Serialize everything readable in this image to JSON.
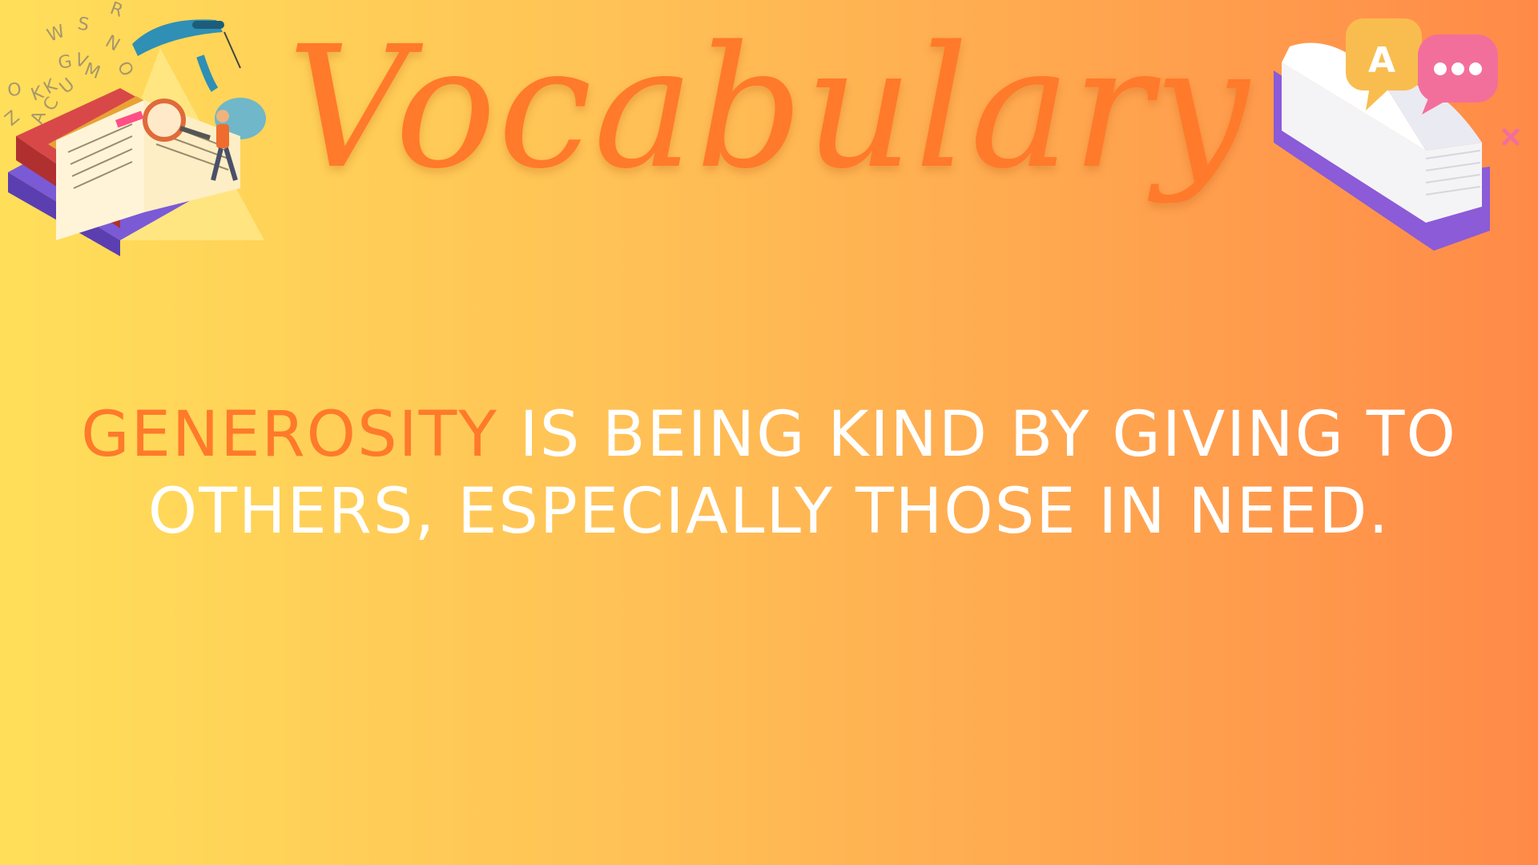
{
  "slide": {
    "title": "Vocabulary",
    "definition": {
      "word": "GENEROSITY",
      "text": " IS BEING KIND BY GIVING TO OTHERS, ESPECIALLY THOSE IN NEED."
    }
  },
  "decorations": {
    "left": {
      "icon": "reading-books-magnifier-icon",
      "letters": "RNOTWMSVGUCAKOZ"
    },
    "right": {
      "icon": "book-chat-bubbles-icon",
      "bubble_letter": "A"
    }
  },
  "colors": {
    "gradient_start": "#ffdf5a",
    "gradient_end": "#ff8a48",
    "accent": "#ff7a2a",
    "text": "#ffffff"
  }
}
